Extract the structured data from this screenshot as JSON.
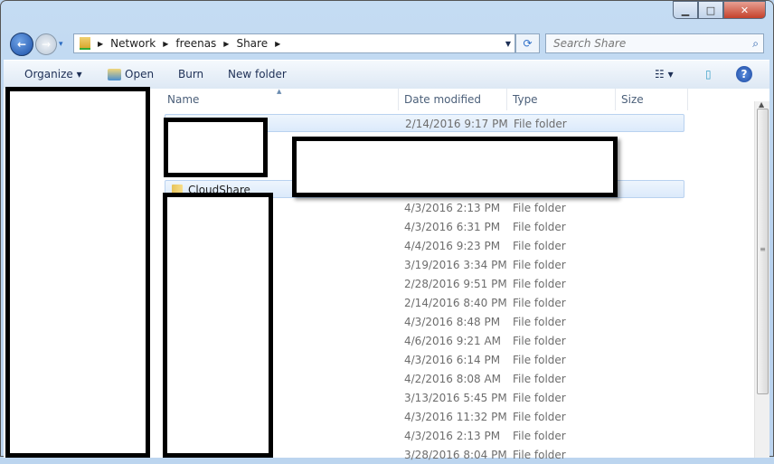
{
  "window": {
    "minimize": "▁",
    "maximize": "□",
    "close": "✕"
  },
  "nav": {
    "back": "←",
    "forward": "→",
    "recent": "▾"
  },
  "address": {
    "crumbs": [
      "Network",
      "freenas",
      "Share"
    ],
    "refresh": "⟳"
  },
  "search": {
    "placeholder": "Search Share",
    "icon": "⌕"
  },
  "toolbar": {
    "organize": "Organize ▾",
    "open": "Open",
    "burn": "Burn",
    "new_folder": "New folder",
    "views": "☷ ▾",
    "preview": "▯",
    "help": "?"
  },
  "columns": [
    "Name",
    "Date modified",
    "Type",
    "Size"
  ],
  "rows": [
    {
      "name": "",
      "date": "2/14/2016 9:17 PM",
      "type": "File folder"
    },
    {
      "name": "CloudShare",
      "date": "",
      "type": ""
    },
    {
      "name": "",
      "date": "4/3/2016 2:13 PM",
      "type": "File folder"
    },
    {
      "name": "",
      "date": "4/3/2016 6:31 PM",
      "type": "File folder"
    },
    {
      "name": "",
      "date": "4/4/2016 9:23 PM",
      "type": "File folder"
    },
    {
      "name": "",
      "date": "3/19/2016 3:34 PM",
      "type": "File folder"
    },
    {
      "name": "",
      "date": "2/28/2016 9:51 PM",
      "type": "File folder"
    },
    {
      "name": "",
      "date": "2/14/2016 8:40 PM",
      "type": "File folder"
    },
    {
      "name": "",
      "date": "4/3/2016 8:48 PM",
      "type": "File folder"
    },
    {
      "name": "",
      "date": "4/6/2016 9:21 AM",
      "type": "File folder"
    },
    {
      "name": "",
      "date": "4/3/2016 6:14 PM",
      "type": "File folder"
    },
    {
      "name": "",
      "date": "4/2/2016 8:08 AM",
      "type": "File folder"
    },
    {
      "name": "",
      "date": "3/13/2016 5:45 PM",
      "type": "File folder"
    },
    {
      "name": "",
      "date": "4/3/2016 11:32 PM",
      "type": "File folder"
    },
    {
      "name": "",
      "date": "4/3/2016 2:13 PM",
      "type": "File folder"
    },
    {
      "name": "",
      "date": "3/28/2016 8:04 PM",
      "type": "File folder"
    }
  ]
}
